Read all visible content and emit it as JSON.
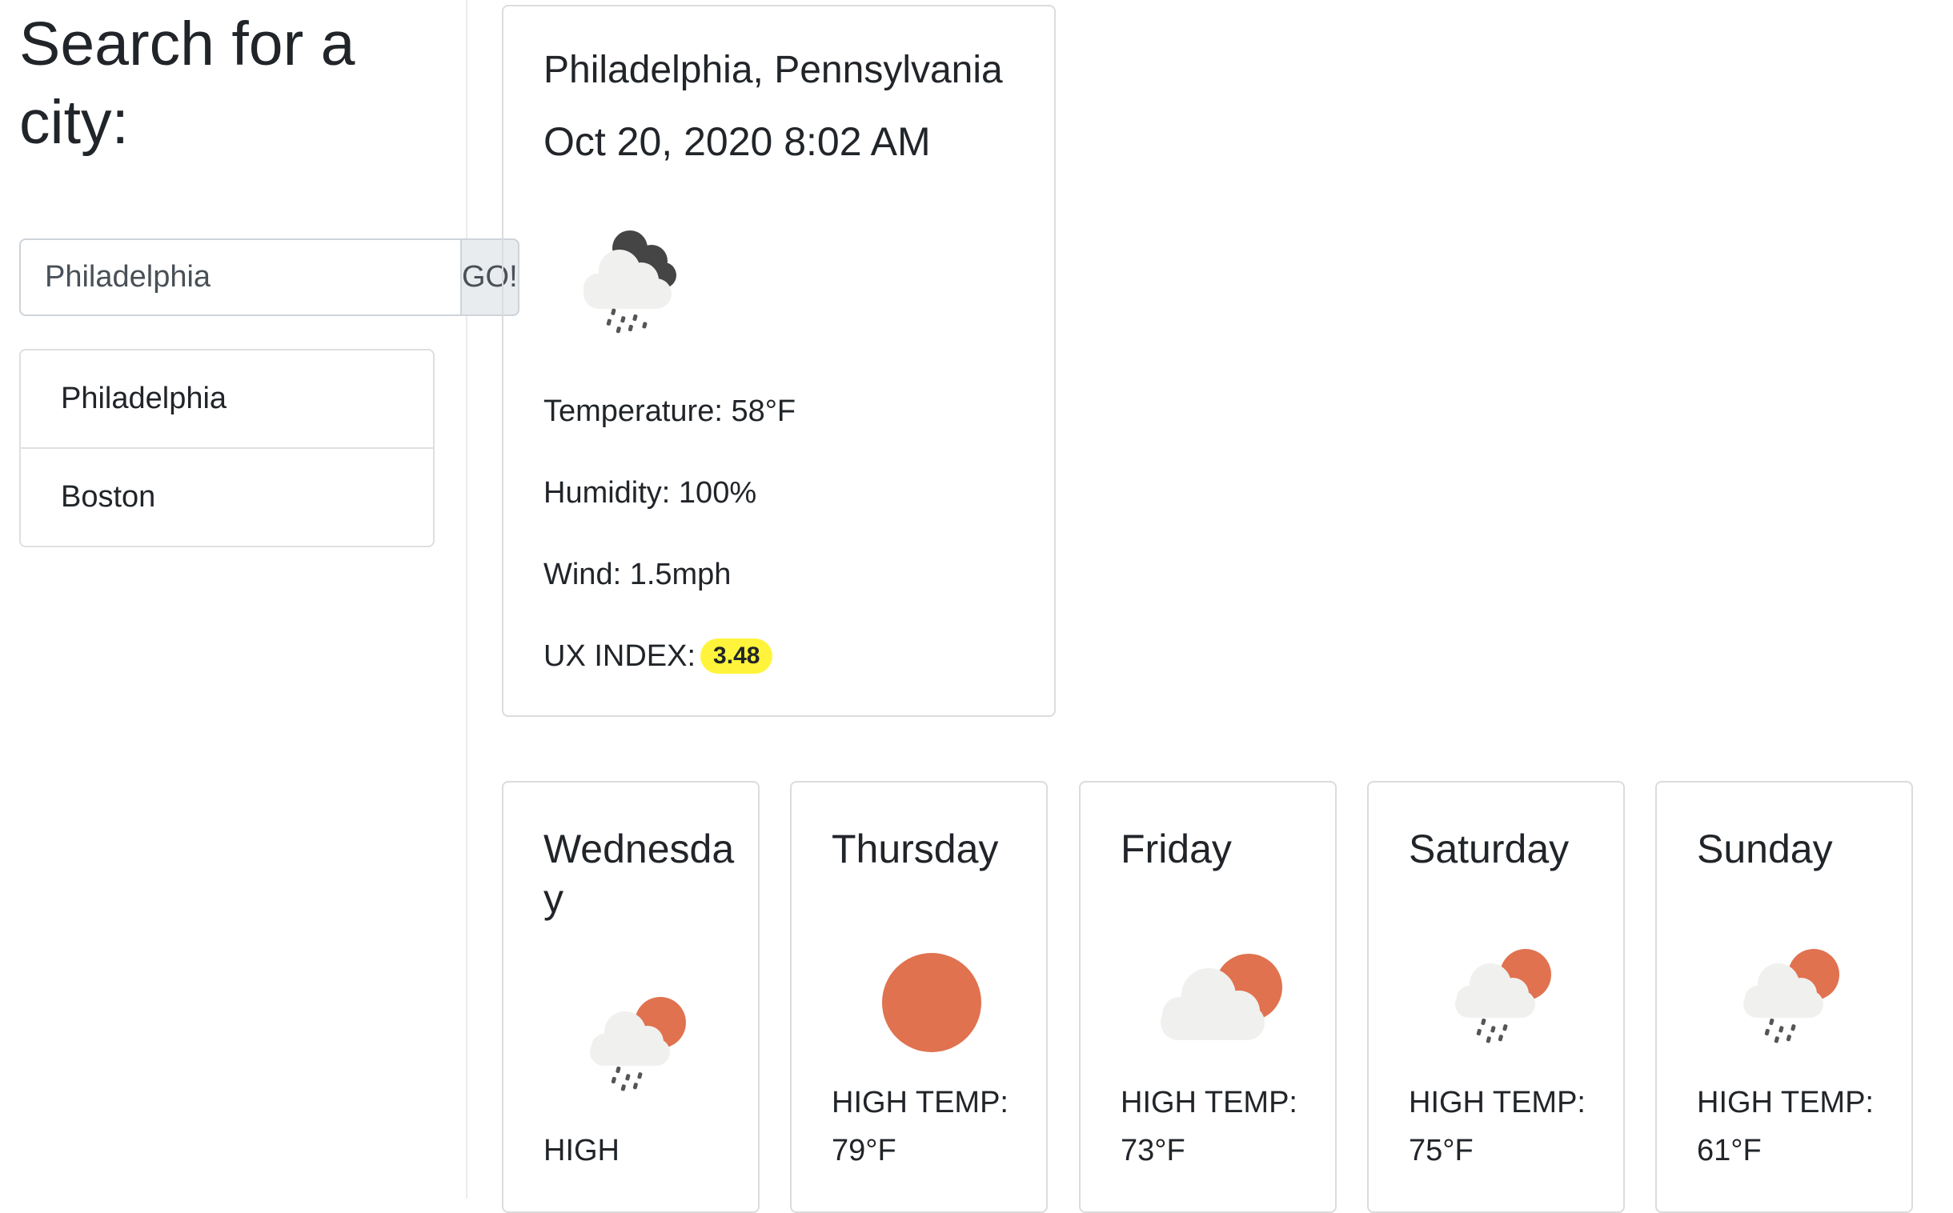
{
  "sidebar": {
    "heading": "Search for a city:",
    "search": {
      "value": "Philadelphia",
      "button_label": "GO!"
    },
    "history": [
      "Philadelphia",
      "Boston"
    ]
  },
  "current": {
    "city": "Philadelphia, Pennsylvania",
    "datetime": "Oct 20, 2020 8:02 AM",
    "icon": "rain-cloud-dark-icon",
    "temperature": "Temperature: 58°F",
    "humidity": "Humidity: 100%",
    "wind": "Wind: 1.5mph",
    "ux_label": "UX INDEX:",
    "ux_value": "3.48"
  },
  "forecast": [
    {
      "day": "Wednesday",
      "icon": "sun-rain-icon",
      "temp": "HIGH"
    },
    {
      "day": "Thursday",
      "icon": "sun-icon",
      "temp": "HIGH TEMP: 79°F"
    },
    {
      "day": "Friday",
      "icon": "sun-cloud-icon",
      "temp": "HIGH TEMP: 73°F"
    },
    {
      "day": "Saturday",
      "icon": "sun-rain-icon",
      "temp": "HIGH TEMP: 75°F"
    },
    {
      "day": "Sunday",
      "icon": "sun-rain-icon",
      "temp": "HIGH TEMP: 61°F"
    }
  ],
  "colors": {
    "sun": "#e07250",
    "cloud": "#f0f0ee",
    "dark_cloud": "#454545",
    "ux_badge": "#fff43b"
  }
}
